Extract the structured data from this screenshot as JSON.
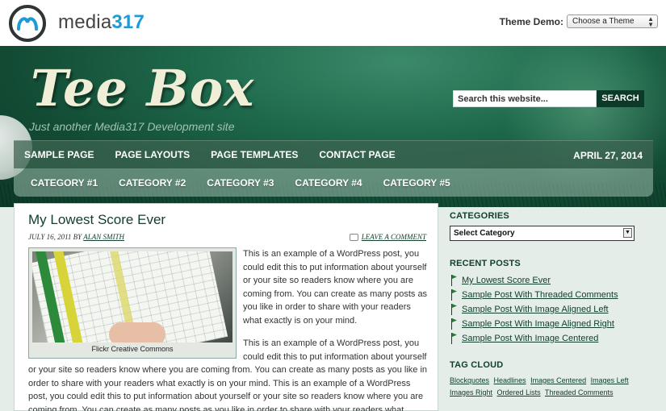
{
  "demo_bar": {
    "logo_text": "media",
    "logo_number": "317",
    "theme_label": "Theme Demo:",
    "theme_select_value": "Choose a Theme"
  },
  "header": {
    "site_title": "Tee Box",
    "tagline": "Just another Media317 Development site",
    "search_placeholder": "Search this website...",
    "search_button": "SEARCH"
  },
  "nav": {
    "pages": [
      "SAMPLE PAGE",
      "PAGE LAYOUTS",
      "PAGE TEMPLATES",
      "CONTACT PAGE"
    ],
    "date": "APRIL 27, 2014",
    "categories": [
      "CATEGORY #1",
      "CATEGORY #2",
      "CATEGORY #3",
      "CATEGORY #4",
      "CATEGORY #5"
    ]
  },
  "post": {
    "title": "My Lowest Score Ever",
    "date": "JULY 16, 2011 BY",
    "author": "ALAN SMITH",
    "comment_link": "LEAVE A COMMENT",
    "image_caption": "Flickr Creative Commons",
    "paragraph1": "This is an example of a WordPress post, you could edit this to put information about yourself or your site so readers know where you are coming from. You can create as many posts as you like in order to share with your readers what exactly is on your mind.",
    "paragraph2": "This is an example of a WordPress post, you could edit this to put information about yourself",
    "paragraph3": "or your site so readers know where you are coming from. You can create as many posts as you like in order to share with your readers what exactly is on your mind. This is an example of a WordPress post, you could edit this to put information about yourself or your site so readers know where you are coming from. You can create as many posts as you like in order to share with your readers what exactly is on"
  },
  "sidebar": {
    "categories_title": "CATEGORIES",
    "category_select": "Select Category",
    "recent_title": "RECENT POSTS",
    "recent_posts": [
      "My Lowest Score Ever",
      "Sample Post With Threaded Comments",
      "Sample Post With Image Aligned Left",
      "Sample Post With Image Aligned Right",
      "Sample Post With Image Centered"
    ],
    "tag_title": "TAG CLOUD",
    "tags": [
      "Blockquotes",
      "Headlines",
      "Images Centered",
      "Images Left",
      "Images Right",
      "Ordered Lists",
      "Threaded Comments"
    ]
  },
  "colors": {
    "header_green": "#1f6a4c",
    "accent_blue": "#1e9bd7",
    "link_green": "#12402c"
  }
}
